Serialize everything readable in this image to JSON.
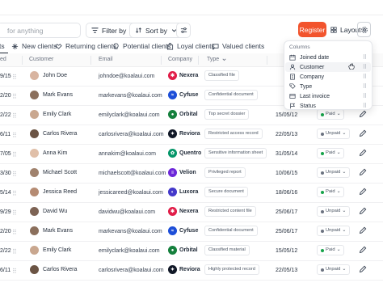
{
  "toolbar": {
    "search_placeholder": "for anything",
    "filter_label": "Filter by",
    "sort_label": "Sort by",
    "register_label": "Register",
    "layout_label": "Layout"
  },
  "tabs": [
    {
      "label": "ts"
    },
    {
      "label": "New clients"
    },
    {
      "label": "Returning clients"
    },
    {
      "label": "Potential clients"
    },
    {
      "label": "Loyal clients"
    },
    {
      "label": "Valued clients"
    }
  ],
  "headers": {
    "date": "ed",
    "customer": "Customer",
    "email": "Email",
    "company": "Company",
    "type": "Type"
  },
  "rows": [
    {
      "date": "9/15",
      "customer": "John Doe",
      "email": "johndoe@koalaui.com",
      "company": "Nexera",
      "type": "Classified file",
      "due": "",
      "status": ""
    },
    {
      "date": "2/20",
      "customer": "Mark Evans",
      "email": "markevans@koalaui.com",
      "company": "Cyfuse",
      "type": "Confidential document",
      "due": "",
      "status": ""
    },
    {
      "date": "2/22",
      "customer": "Emily Clark",
      "email": "emilyclark@koalaui.com",
      "company": "Orbital",
      "type": "Top secret dossier",
      "due": "15/05/12",
      "status": "Paid"
    },
    {
      "date": "6/11",
      "customer": "Carlos Rivera",
      "email": "carlosrivera@koalaui.com",
      "company": "Reviora",
      "type": "Restricted access record",
      "due": "22/05/13",
      "status": "Unpaid"
    },
    {
      "date": "7/05",
      "customer": "Anna Kim",
      "email": "annakim@koalaui.com",
      "company": "Quentro",
      "type": "Sensitive information sheet",
      "due": "31/05/14",
      "status": "Paid"
    },
    {
      "date": "3/30",
      "customer": "Michael Scott",
      "email": "michaelscott@koalaui.com",
      "company": "Velion",
      "type": "Privileged report",
      "due": "10/06/15",
      "status": "Unpaid"
    },
    {
      "date": "5/14",
      "customer": "Jessica Reed",
      "email": "jessicareed@koalaui.com",
      "company": "Luxora",
      "type": "Secure document",
      "due": "18/06/16",
      "status": "Paid"
    },
    {
      "date": "9/29",
      "customer": "David Wu",
      "email": "davidwu@koalaui.com",
      "company": "Nexera",
      "type": "Restricted content file",
      "due": "25/06/17",
      "status": "Unpaid"
    },
    {
      "date": "2/20",
      "customer": "Mark Evans",
      "email": "markevans@koalaui.com",
      "company": "Cyfuse",
      "type": "Confidential document",
      "due": "25/06/17",
      "status": "Unpaid"
    },
    {
      "date": "2/22",
      "customer": "Emily Clark",
      "email": "emilyclark@koalaui.com",
      "company": "Orbital",
      "type": "Classified material",
      "due": "15/05/12",
      "status": "Paid"
    },
    {
      "date": "6/11",
      "customer": "Carlos Rivera",
      "email": "carlosrivera@koalaui.com",
      "company": "Reviora",
      "type": "Highly protected record",
      "due": "22/05/13",
      "status": "Unpaid"
    }
  ],
  "columns_menu": {
    "title": "Columns",
    "items": [
      {
        "label": "Joined date",
        "icon": "calendar-icon"
      },
      {
        "label": "Customer",
        "icon": "user-icon"
      },
      {
        "label": "Company",
        "icon": "building-icon"
      },
      {
        "label": "Type",
        "icon": "tag-icon"
      },
      {
        "label": "Last invoice",
        "icon": "invoice-icon"
      },
      {
        "label": "Status",
        "icon": "flag-icon"
      }
    ]
  },
  "colors": {
    "accent": "#f2542d",
    "paid": "#16a34a",
    "unpaid": "#6b7280",
    "nexera": "#e11d48",
    "cyfuse": "#1d4ed8",
    "orbital": "#15803d",
    "reviora": "#111827",
    "quentro": "#059669",
    "velion": "#6d28d9",
    "luxora": "#4338ca"
  }
}
